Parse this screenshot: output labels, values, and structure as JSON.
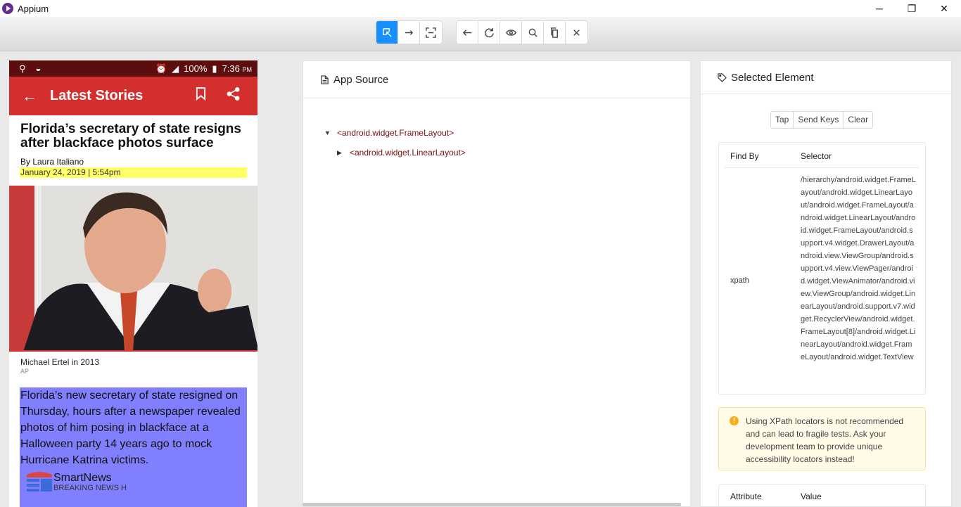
{
  "window": {
    "title": "Appium",
    "minimize": "─",
    "restore": "❐",
    "close": "✕"
  },
  "toolbar": {
    "group1": [
      {
        "name": "select-elements-icon",
        "active": true
      },
      {
        "name": "swipe-by-coordinates-icon",
        "active": false
      },
      {
        "name": "tap-by-coordinates-icon",
        "active": false
      }
    ],
    "group2": [
      {
        "name": "back-icon"
      },
      {
        "name": "refresh-icon"
      },
      {
        "name": "eye-icon"
      },
      {
        "name": "search-icon"
      },
      {
        "name": "copy-xml-icon"
      },
      {
        "name": "close-icon"
      }
    ]
  },
  "phone": {
    "status": {
      "battery": "100%",
      "time": "7:36",
      "ampm": "PM"
    },
    "app_bar": {
      "back": "←",
      "title": "Latest Stories"
    },
    "article": {
      "headline": "Florida’s secretary of state resigns after blackface photos surface",
      "byline": "By Laura Italiano",
      "date": "January 24, 2019 | 5:54pm",
      "caption": "Michael Ertel in 2013",
      "credit": "AP",
      "body": "Florida’s new secretary of state resigned on Thursday, hours after a newspaper revealed photos of him posing in blackface at a Halloween party 14 years ago to mock Hurricane Katrina victims.",
      "promo_title": "SmartNews",
      "promo_sub": "BREAKING NEWS H"
    }
  },
  "source_panel": {
    "title": "App Source",
    "tree": [
      {
        "label": "<android.widget.FrameLayout>",
        "caret": "▼"
      },
      {
        "label": "<android.widget.LinearLayout>",
        "caret": "▶"
      }
    ]
  },
  "selected_panel": {
    "title": "Selected Element",
    "actions": [
      "Tap",
      "Send Keys",
      "Clear"
    ],
    "find_table": {
      "col_find_by": "Find By",
      "col_selector": "Selector",
      "key": "xpath",
      "value": "/hierarchy/android.widget.FrameLayout/android.widget.LinearLayout/android.widget.FrameLayout/android.widget.LinearLayout/android.widget.FrameLayout/android.support.v4.widget.DrawerLayout/android.view.ViewGroup/android.support.v4.view.ViewPager/android.widget.ViewAnimator/android.view.ViewGroup/android.widget.LinearLayout/android.support.v7.widget.RecyclerView/android.widget.FrameLayout[8]/android.widget.LinearLayout/android.widget.FrameLayout/android.widget.TextView"
    },
    "warning": {
      "icon": "!",
      "text": "Using XPath locators is not recommended and can lead to fragile tests. Ask your development team to provide unique accessibility locators instead!"
    },
    "attr_table": {
      "col_attribute": "Attribute",
      "col_value": "Value"
    }
  }
}
